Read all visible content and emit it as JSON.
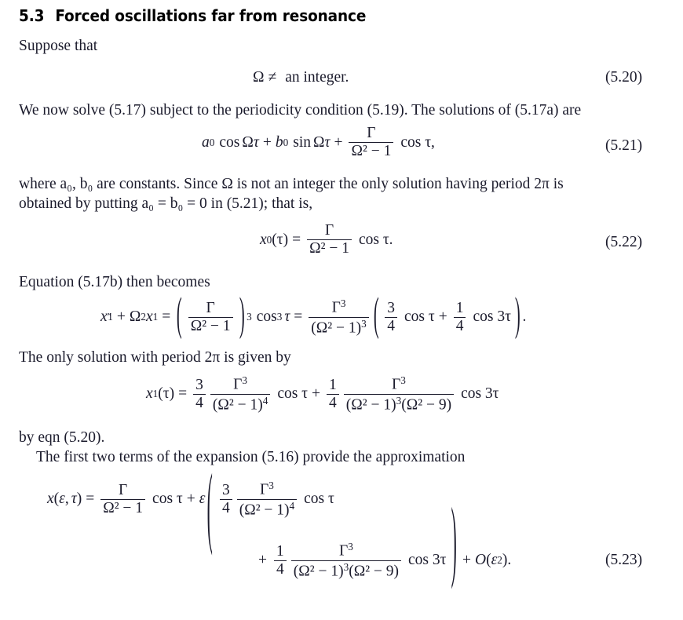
{
  "document": {
    "section": {
      "number": "5.3",
      "title": "Forced oscillations far from resonance"
    },
    "paragraphs": {
      "p1": "Suppose that",
      "p2": "We now solve (5.17) subject to the periodicity condition (5.19). The solutions of (5.17a) are",
      "p3_line1": "where a₀, b₀ are constants. Since Ω is not an integer the only solution having period 2π is",
      "p3_line2": "obtained by putting a₀ = b₀ = 0 in (5.21); that is,",
      "p4": "Equation (5.17b) then becomes",
      "p5": "The only solution with period 2π is given by",
      "p6_line1": "by eqn (5.20).",
      "p6_line2": "The first two terms of the expansion (5.16) provide the approximation"
    },
    "equations": {
      "eq520": {
        "number": "(5.20)",
        "latex": "\\Omega \\neq \\text{an integer.}",
        "parts": {
          "omega": "Ω",
          "relation": "≠",
          "text": "an integer."
        }
      },
      "eq521": {
        "number": "(5.21)",
        "latex": "a_0\\cos\\Omega\\tau + b_0\\sin\\Omega\\tau + \\frac{\\Gamma}{\\Omega^2-1}\\cos\\tau,",
        "parts": {
          "a": "a",
          "a_sub": "0",
          "cos": "cos",
          "omega": "Ω",
          "tau": "τ",
          "plus": "+",
          "b": "b",
          "b_sub": "0",
          "sin": "sin",
          "gamma": "Γ",
          "den": "Ω² − 1",
          "trail": "cos τ,"
        }
      },
      "eq522": {
        "number": "(5.22)",
        "latex": "x_0(\\tau) = \\frac{\\Gamma}{\\Omega^2-1}\\cos\\tau.",
        "parts": {
          "lhs_x": "x",
          "lhs_sub": "0",
          "lhs_arg": "(τ)",
          "equals": "=",
          "gamma": "Γ",
          "den": "Ω² − 1",
          "trail": "cos τ."
        }
      },
      "eq_unnumbered_1": {
        "number": "",
        "latex": "x_1'' + \\Omega^2 x_1 = \\left(\\frac{\\Gamma}{\\Omega^2-1}\\right)^3\\cos^3\\tau = \\frac{\\Gamma^3}{(\\Omega^2-1)^3}\\left(\\tfrac{3}{4}\\cos\\tau + \\tfrac{1}{4}\\cos 3\\tau\\right).",
        "parts": {
          "x": "x",
          "x_sub": "1",
          "x_sup": "″",
          "plus": "+",
          "omega2": "Ω",
          "omega_sup": "2",
          "equals": "=",
          "gamma": "Γ",
          "den1": "Ω² − 1",
          "power3": "3",
          "cos3tau": "cos",
          "tau": "τ",
          "gamma3_num": "Γ",
          "gamma3_sup": "3",
          "den2": "(Ω² − 1)",
          "den2_sup": "3",
          "three": "3",
          "four": "4",
          "one": "1",
          "cos_tau": "cos τ",
          "cos_3tau": "cos 3τ",
          "end": "."
        }
      },
      "eq_unnumbered_2": {
        "number": "",
        "latex": "x_1(\\tau) = \\frac{3}{4}\\frac{\\Gamma^3}{(\\Omega^2-1)^4}\\cos\\tau + \\frac{1}{4}\\frac{\\Gamma^3}{(\\Omega^2-1)^3(\\Omega^2-9)}\\cos 3\\tau",
        "parts": {
          "lhs": "x",
          "lhs_sub": "1",
          "lhs_arg": "(τ)",
          "equals": "=",
          "three": "3",
          "four": "4",
          "gamma": "Γ",
          "gamma_sup": "3",
          "den1": "(Ω² − 1)",
          "den1_sup": "4",
          "cos_tau": "cos τ",
          "plus": "+",
          "one": "1",
          "den2a": "(Ω² − 1)",
          "den2a_sup": "3",
          "den2b": "(Ω² − 9)",
          "cos_3tau": "cos 3τ"
        }
      },
      "eq523": {
        "number": "(5.23)",
        "latex": "x(\\varepsilon,\\tau) = \\frac{\\Gamma}{\\Omega^2-1}\\cos\\tau + \\varepsilon\\left(\\frac{3}{4}\\frac{\\Gamma^3}{(\\Omega^2-1)^4}\\cos\\tau + \\frac{1}{4}\\frac{\\Gamma^3}{(\\Omega^2-1)^3(\\Omega^2-9)}\\cos 3\\tau\\right) + O(\\varepsilon^2).",
        "parts": {
          "lhs": "x",
          "lhs_arg_open": "(",
          "eps": "ε",
          "comma": ",",
          "tau": "τ",
          "lhs_arg_close": ")",
          "equals": "=",
          "gamma": "Γ",
          "den0": "Ω² − 1",
          "cos_tau": "cos τ",
          "plus": "+",
          "three": "3",
          "four": "4",
          "gamma_sup": "3",
          "den1": "(Ω² − 1)",
          "den1_sup": "4",
          "one": "1",
          "den2a": "(Ω² − 1)",
          "den2a_sup": "3",
          "den2b": "(Ω² − 9)",
          "cos_3tau": "cos 3τ",
          "bigO": "O",
          "bigO_arg_open": "(",
          "bigO_eps": "ε",
          "bigO_sup": "2",
          "bigO_close": ").",
          "end": "."
        }
      }
    },
    "colors": {
      "text": "#1b1b2c",
      "heading": "#000000",
      "background": "#ffffff"
    }
  }
}
